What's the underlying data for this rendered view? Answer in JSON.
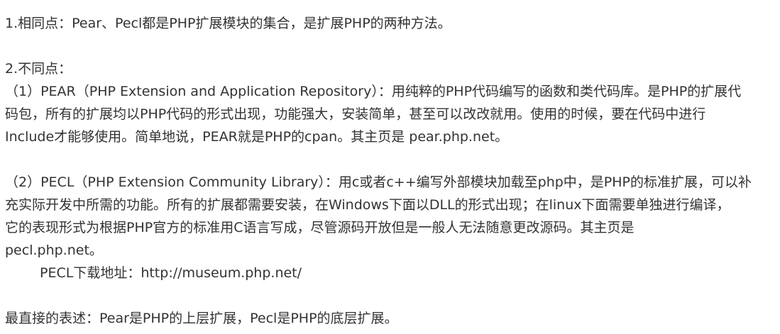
{
  "article": {
    "similarity": "1.相同点：Pear、Pecl都是PHP扩展模块的集合，是扩展PHP的两种方法。",
    "difference_heading": "2.不同点：",
    "pear": [
      "（1）PEAR（PHP Extension and Application Repository）：用纯粹的PHP代码编写的函数和类代码库。是PHP的扩展代",
      "码包，所有的扩展均以PHP代码的形式出现，功能强大，安装简单，甚至可以改改就用。使用的时候，要在代码中进行",
      "Include才能够使用。简单地说，PEAR就是PHP的cpan。其主页是 pear.php.net。"
    ],
    "pecl": [
      "（2）PECL（PHP Extension Community Library）：用c或者c++编写外部模块加载至php中，是PHP的标准扩展，可以补",
      "充实际开发中所需的功能。所有的扩展都需要安装，在Windows下面以DLL的形式出现；在linux下面需要单独进行编译，",
      "它的表现形式为根据PHP官方的标准用C语言写成，尽管源码开放但是一般人无法随意更改源码。其主页是",
      "pecl.php.net。"
    ],
    "pecl_download": "PECL下载地址：http://museum.php.net/",
    "summary": "最直接的表述：Pear是PHP的上层扩展，Pecl是PHP的底层扩展。"
  }
}
